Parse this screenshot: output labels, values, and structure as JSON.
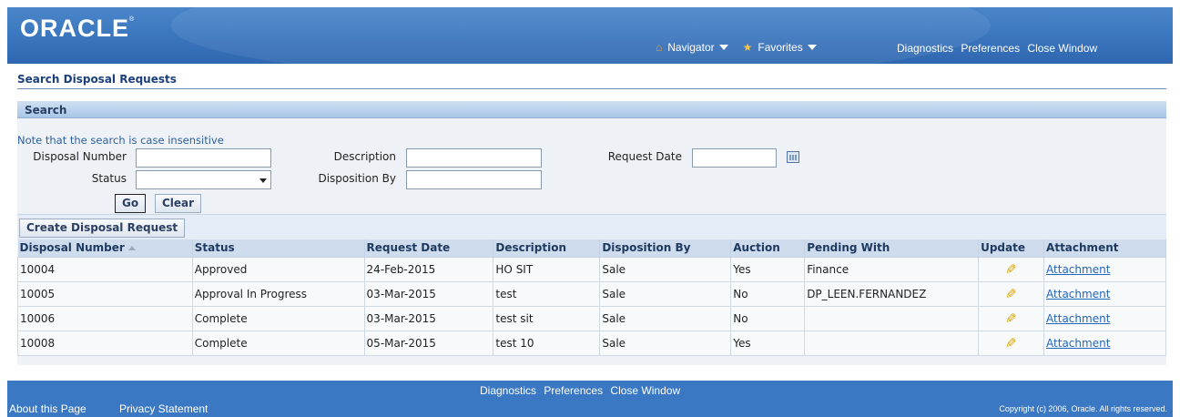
{
  "header": {
    "logo": "ORACLE",
    "logo_mark": "®",
    "navigator": "Navigator",
    "favorites": "Favorites",
    "global_links": [
      "Diagnostics",
      "Preferences",
      "Close Window"
    ]
  },
  "page": {
    "title": "Search Disposal Requests"
  },
  "search": {
    "header": "Search",
    "note": "Note that the search is case insensitive",
    "labels": {
      "disposal_number": "Disposal Number",
      "status": "Status",
      "description": "Description",
      "disposition_by": "Disposition By",
      "request_date": "Request Date"
    },
    "values": {
      "disposal_number": "",
      "status": "",
      "description": "",
      "disposition_by": "",
      "request_date": ""
    },
    "go_label": "Go",
    "clear_label": "Clear"
  },
  "results": {
    "create_label": "Create Disposal Request",
    "columns": [
      "Disposal Number",
      "Status",
      "Request Date",
      "Description",
      "Disposition By",
      "Auction",
      "Pending With",
      "Update",
      "Attachment"
    ],
    "rows": [
      {
        "number": "10004",
        "status": "Approved",
        "date": "24-Feb-2015",
        "description": "HO SIT",
        "disposition": "Sale",
        "auction": "Yes",
        "pending": "Finance",
        "attachment": "Attachment"
      },
      {
        "number": "10005",
        "status": "Approval In Progress",
        "date": "03-Mar-2015",
        "description": "test",
        "disposition": "Sale",
        "auction": "No",
        "pending": "DP_LEEN.FERNANDEZ",
        "attachment": "Attachment"
      },
      {
        "number": "10006",
        "status": "Complete",
        "date": "03-Mar-2015",
        "description": "test sit",
        "disposition": "Sale",
        "auction": "No",
        "pending": "",
        "attachment": "Attachment"
      },
      {
        "number": "10008",
        "status": "Complete",
        "date": "05-Mar-2015",
        "description": "test 10",
        "disposition": "Sale",
        "auction": "Yes",
        "pending": "",
        "attachment": "Attachment"
      }
    ]
  },
  "footer": {
    "links": [
      "Diagnostics",
      "Preferences",
      "Close Window"
    ],
    "about": "About this Page",
    "privacy": "Privacy Statement",
    "copyright": "Copyright (c) 2006, Oracle. All rights reserved."
  },
  "colors": {
    "brand_blue": "#3a78c3",
    "link_blue": "#2266bb",
    "title_navy": "#1c3f7c"
  }
}
